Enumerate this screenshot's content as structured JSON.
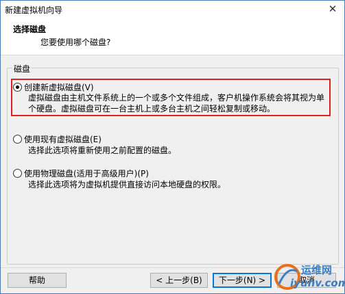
{
  "window": {
    "title": "新建虚拟机向导",
    "close_glyph": "✕"
  },
  "header": {
    "title": "选择磁盘",
    "subtitle": "您要使用哪个磁盘?"
  },
  "group": {
    "label": "磁盘"
  },
  "options": [
    {
      "label": "创建新虚拟磁盘(V)",
      "checked": true,
      "desc": "虚拟磁盘由主机文件系统上的一个或多个文件组成，客户机操作系统会将其视为单个硬盘。虚拟磁盘可在一台主机上或多台主机之间轻松复制或移动。"
    },
    {
      "label": "使用现有虚拟磁盘(E)",
      "checked": false,
      "desc": "选择此选项将重新使用之前配置的磁盘。"
    },
    {
      "label": "使用物理磁盘(适用于高级用户)(P)",
      "checked": false,
      "desc": "选择此选项将为虚拟机提供直接访问本地硬盘的权限。"
    }
  ],
  "buttons": {
    "help": "帮助",
    "back": "< 上一步(B)",
    "next": "下一步(N) >",
    "cancel": "取消"
  },
  "watermark": {
    "line1": "运维网",
    "line2": "iyunv.com"
  },
  "colors": {
    "highlight": "#e02020",
    "accent": "#0078d7"
  }
}
